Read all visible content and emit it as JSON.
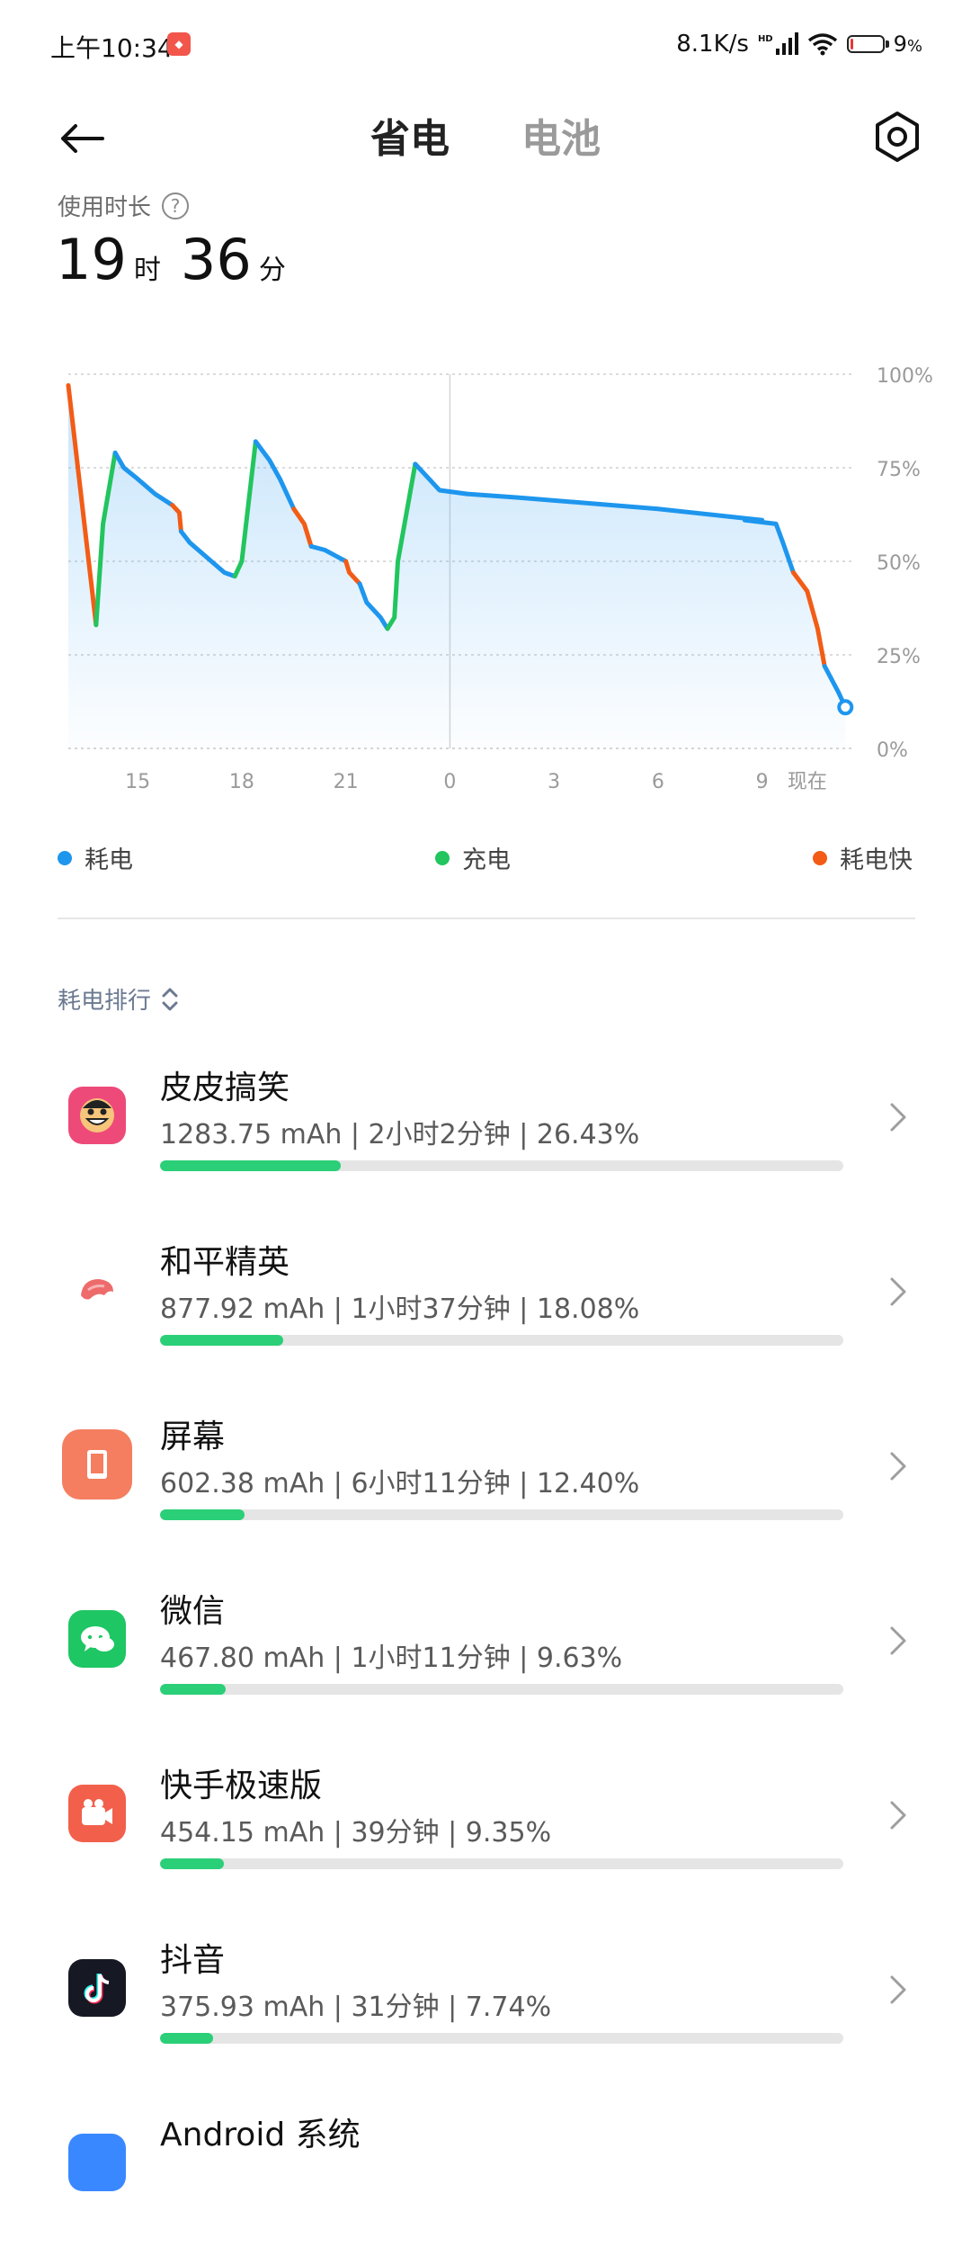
{
  "status_bar": {
    "time": "上午10:34",
    "net_speed": "8.1K/s",
    "hd": "HD",
    "battery_pct": "9",
    "battery_level": 0.09
  },
  "header": {
    "tabs": [
      {
        "label": "省电",
        "active": true
      },
      {
        "label": "电池",
        "active": false
      }
    ]
  },
  "usage": {
    "label": "使用时长",
    "hours": "19",
    "hours_unit": "时",
    "minutes": "36",
    "minutes_unit": "分"
  },
  "chart_data": {
    "type": "line",
    "x_tick_labels": [
      "15",
      "18",
      "21",
      "0",
      "3",
      "6",
      "9",
      "现在"
    ],
    "y_tick_labels": [
      "100%",
      "75%",
      "50%",
      "25%",
      "0%"
    ],
    "ylim": [
      0,
      100
    ],
    "xlim": [
      13,
      10.6
    ],
    "grid": true,
    "colors": {
      "drain": "#1e96ee",
      "charge": "#22c55e",
      "fast_drain": "#f25c16"
    },
    "series": [
      {
        "name": "耗电快",
        "color": "#f25c16",
        "points": [
          [
            13.0,
            97
          ],
          [
            13.8,
            33
          ]
        ]
      },
      {
        "name": "充电",
        "color": "#22c55e",
        "points": [
          [
            13.8,
            33
          ],
          [
            14.0,
            60
          ],
          [
            14.35,
            79
          ]
        ]
      },
      {
        "name": "耗电",
        "color": "#1e96ee",
        "points": [
          [
            14.35,
            79
          ],
          [
            14.6,
            75
          ],
          [
            15.0,
            72
          ],
          [
            15.5,
            68
          ],
          [
            16.0,
            65
          ]
        ]
      },
      {
        "name": "耗电快",
        "color": "#f25c16",
        "points": [
          [
            16.0,
            65
          ],
          [
            16.2,
            63
          ],
          [
            16.25,
            58
          ]
        ]
      },
      {
        "name": "耗电",
        "color": "#1e96ee",
        "points": [
          [
            16.25,
            58
          ],
          [
            16.5,
            55
          ],
          [
            17.0,
            51
          ],
          [
            17.5,
            47
          ],
          [
            17.8,
            46
          ]
        ]
      },
      {
        "name": "充电",
        "color": "#22c55e",
        "points": [
          [
            17.8,
            46
          ],
          [
            18.0,
            50
          ],
          [
            18.4,
            82
          ]
        ]
      },
      {
        "name": "耗电",
        "color": "#1e96ee",
        "points": [
          [
            18.4,
            82
          ],
          [
            18.8,
            77
          ],
          [
            19.1,
            72
          ],
          [
            19.5,
            64
          ]
        ]
      },
      {
        "name": "耗电快",
        "color": "#f25c16",
        "points": [
          [
            19.5,
            64
          ],
          [
            19.8,
            60
          ],
          [
            20.0,
            54
          ]
        ]
      },
      {
        "name": "耗电",
        "color": "#1e96ee",
        "points": [
          [
            20.0,
            54
          ],
          [
            20.4,
            53
          ],
          [
            21.0,
            50
          ]
        ]
      },
      {
        "name": "耗电快",
        "color": "#f25c16",
        "points": [
          [
            21.0,
            50
          ],
          [
            21.1,
            47
          ],
          [
            21.4,
            44
          ]
        ]
      },
      {
        "name": "耗电",
        "color": "#1e96ee",
        "points": [
          [
            21.4,
            44
          ],
          [
            21.6,
            39
          ],
          [
            22.0,
            35
          ],
          [
            22.2,
            32
          ]
        ]
      },
      {
        "name": "充电",
        "color": "#22c55e",
        "points": [
          [
            22.2,
            32
          ],
          [
            22.4,
            35
          ],
          [
            22.5,
            50
          ],
          [
            23.0,
            76
          ]
        ]
      },
      {
        "name": "耗电",
        "color": "#1e96ee",
        "points": [
          [
            23.0,
            76
          ],
          [
            23.4,
            72
          ],
          [
            23.7,
            69
          ],
          [
            24.5,
            68
          ],
          [
            26.0,
            67
          ],
          [
            30.0,
            64
          ],
          [
            33.0,
            61
          ],
          [
            32.5,
            61
          ],
          [
            33.4,
            60
          ],
          [
            33.6,
            55
          ],
          [
            33.9,
            47
          ]
        ]
      },
      {
        "name": "耗电快",
        "color": "#f25c16",
        "points": [
          [
            33.9,
            47
          ],
          [
            34.3,
            42
          ],
          [
            34.6,
            32
          ],
          [
            34.8,
            22
          ]
        ]
      },
      {
        "name": "耗电",
        "color": "#1e96ee",
        "points": [
          [
            34.8,
            22
          ],
          [
            35.2,
            15
          ],
          [
            35.4,
            11
          ]
        ]
      }
    ]
  },
  "legend": [
    {
      "label": "耗电",
      "color": "#1e96ee"
    },
    {
      "label": "充电",
      "color": "#22c55e"
    },
    {
      "label": "耗电快",
      "color": "#f25c16"
    }
  ],
  "ranking_title": "耗电排行",
  "apps": [
    {
      "name": "皮皮搞笑",
      "detail": "1283.75 mAh | 2小时2分钟 | 26.43%",
      "pct": 26.43,
      "icon": "pipi-icon",
      "icon_bg": "#ee4a79"
    },
    {
      "name": "和平精英",
      "detail": "877.92 mAh | 1小时37分钟 | 18.08%",
      "pct": 18.08,
      "icon": "pubg-icon",
      "icon_bg": "#ffffff"
    },
    {
      "name": "屏幕",
      "detail": "602.38 mAh | 6小时11分钟 | 12.40%",
      "pct": 12.4,
      "icon": "screen-icon",
      "icon_bg": "#f47e5f"
    },
    {
      "name": "微信",
      "detail": "467.80 mAh | 1小时11分钟 | 9.63%",
      "pct": 9.63,
      "icon": "wechat-icon",
      "icon_bg": "#1ec664"
    },
    {
      "name": "快手极速版",
      "detail": "454.15 mAh | 39分钟 | 9.35%",
      "pct": 9.35,
      "icon": "kuaishou-icon",
      "icon_bg": "#f2604c"
    },
    {
      "name": "抖音",
      "detail": "375.93 mAh | 31分钟 | 7.74%",
      "pct": 7.74,
      "icon": "douyin-icon",
      "icon_bg": "#161823"
    },
    {
      "name": "Android 系统",
      "detail": "",
      "pct": 0,
      "icon": "android-icon",
      "icon_bg": "#3a88ff"
    }
  ]
}
